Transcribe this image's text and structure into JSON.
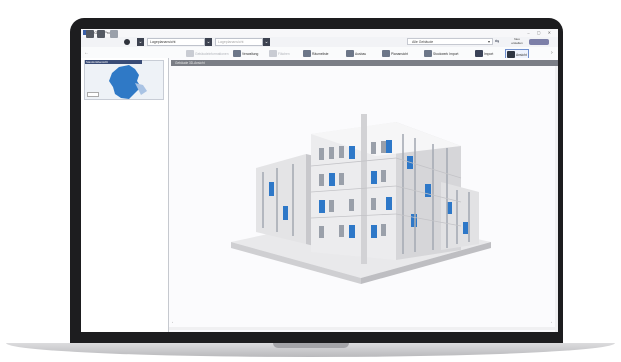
{
  "app": {
    "title": "nxGEO Pro",
    "window_controls": "– ▢ ✕"
  },
  "toolbar": {
    "dropdown_primary": "Lageplanansicht",
    "dropdown_secondary": "Lageplanansicht",
    "search_combo": "Alle Gebäude",
    "neu_button": "Neu erstellen"
  },
  "ribbon": {
    "items": [
      {
        "label": "Gebäudeinformationen",
        "enabled": false
      },
      {
        "label": "Verwaltung",
        "enabled": true
      },
      {
        "label": "Flächen",
        "enabled": false
      },
      {
        "label": "Räumeliste",
        "enabled": true
      },
      {
        "label": "Ausbau",
        "enabled": true
      },
      {
        "label": "Planansicht",
        "enabled": true
      },
      {
        "label": "Stockwerk Import",
        "enabled": true
      },
      {
        "label": "Import",
        "enabled": true
      },
      {
        "label": "Ansicht",
        "enabled": true,
        "selected": true
      }
    ]
  },
  "left_panel": {
    "map_title": "Standortübersicht"
  },
  "viewport": {
    "tab_label": "Gebäude 3D-Ansicht"
  },
  "colors": {
    "bezel": "#1d1d1f",
    "accent_blue": "#2e78c8",
    "facade": "#e6e6e8",
    "viewport_bg": "#fbfbfd"
  }
}
